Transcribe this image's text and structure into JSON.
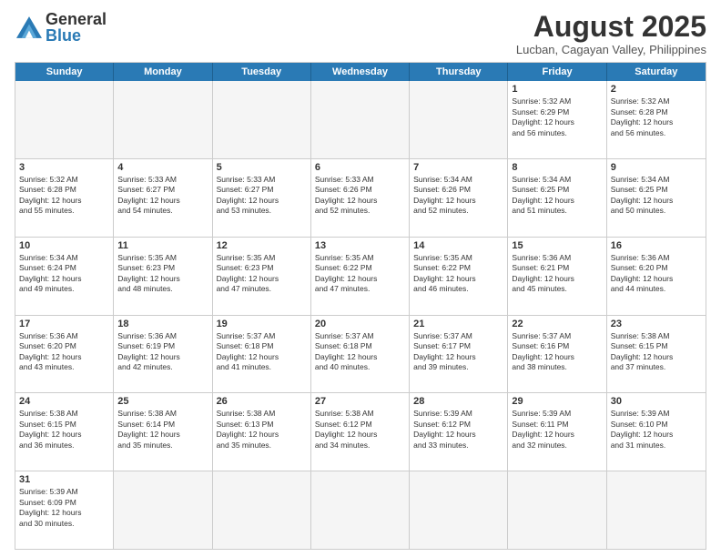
{
  "logo": {
    "general": "General",
    "blue": "Blue"
  },
  "title": {
    "month_year": "August 2025",
    "location": "Lucban, Cagayan Valley, Philippines"
  },
  "header": {
    "days": [
      "Sunday",
      "Monday",
      "Tuesday",
      "Wednesday",
      "Thursday",
      "Friday",
      "Saturday"
    ]
  },
  "weeks": [
    {
      "cells": [
        {
          "day": "",
          "info": "",
          "empty": true
        },
        {
          "day": "",
          "info": "",
          "empty": true
        },
        {
          "day": "",
          "info": "",
          "empty": true
        },
        {
          "day": "",
          "info": "",
          "empty": true
        },
        {
          "day": "",
          "info": "",
          "empty": true
        },
        {
          "day": "1",
          "info": "Sunrise: 5:32 AM\nSunset: 6:29 PM\nDaylight: 12 hours\nand 56 minutes.",
          "empty": false
        },
        {
          "day": "2",
          "info": "Sunrise: 5:32 AM\nSunset: 6:28 PM\nDaylight: 12 hours\nand 56 minutes.",
          "empty": false
        }
      ]
    },
    {
      "cells": [
        {
          "day": "3",
          "info": "Sunrise: 5:32 AM\nSunset: 6:28 PM\nDaylight: 12 hours\nand 55 minutes.",
          "empty": false
        },
        {
          "day": "4",
          "info": "Sunrise: 5:33 AM\nSunset: 6:27 PM\nDaylight: 12 hours\nand 54 minutes.",
          "empty": false
        },
        {
          "day": "5",
          "info": "Sunrise: 5:33 AM\nSunset: 6:27 PM\nDaylight: 12 hours\nand 53 minutes.",
          "empty": false
        },
        {
          "day": "6",
          "info": "Sunrise: 5:33 AM\nSunset: 6:26 PM\nDaylight: 12 hours\nand 52 minutes.",
          "empty": false
        },
        {
          "day": "7",
          "info": "Sunrise: 5:34 AM\nSunset: 6:26 PM\nDaylight: 12 hours\nand 52 minutes.",
          "empty": false
        },
        {
          "day": "8",
          "info": "Sunrise: 5:34 AM\nSunset: 6:25 PM\nDaylight: 12 hours\nand 51 minutes.",
          "empty": false
        },
        {
          "day": "9",
          "info": "Sunrise: 5:34 AM\nSunset: 6:25 PM\nDaylight: 12 hours\nand 50 minutes.",
          "empty": false
        }
      ]
    },
    {
      "cells": [
        {
          "day": "10",
          "info": "Sunrise: 5:34 AM\nSunset: 6:24 PM\nDaylight: 12 hours\nand 49 minutes.",
          "empty": false
        },
        {
          "day": "11",
          "info": "Sunrise: 5:35 AM\nSunset: 6:23 PM\nDaylight: 12 hours\nand 48 minutes.",
          "empty": false
        },
        {
          "day": "12",
          "info": "Sunrise: 5:35 AM\nSunset: 6:23 PM\nDaylight: 12 hours\nand 47 minutes.",
          "empty": false
        },
        {
          "day": "13",
          "info": "Sunrise: 5:35 AM\nSunset: 6:22 PM\nDaylight: 12 hours\nand 47 minutes.",
          "empty": false
        },
        {
          "day": "14",
          "info": "Sunrise: 5:35 AM\nSunset: 6:22 PM\nDaylight: 12 hours\nand 46 minutes.",
          "empty": false
        },
        {
          "day": "15",
          "info": "Sunrise: 5:36 AM\nSunset: 6:21 PM\nDaylight: 12 hours\nand 45 minutes.",
          "empty": false
        },
        {
          "day": "16",
          "info": "Sunrise: 5:36 AM\nSunset: 6:20 PM\nDaylight: 12 hours\nand 44 minutes.",
          "empty": false
        }
      ]
    },
    {
      "cells": [
        {
          "day": "17",
          "info": "Sunrise: 5:36 AM\nSunset: 6:20 PM\nDaylight: 12 hours\nand 43 minutes.",
          "empty": false
        },
        {
          "day": "18",
          "info": "Sunrise: 5:36 AM\nSunset: 6:19 PM\nDaylight: 12 hours\nand 42 minutes.",
          "empty": false
        },
        {
          "day": "19",
          "info": "Sunrise: 5:37 AM\nSunset: 6:18 PM\nDaylight: 12 hours\nand 41 minutes.",
          "empty": false
        },
        {
          "day": "20",
          "info": "Sunrise: 5:37 AM\nSunset: 6:18 PM\nDaylight: 12 hours\nand 40 minutes.",
          "empty": false
        },
        {
          "day": "21",
          "info": "Sunrise: 5:37 AM\nSunset: 6:17 PM\nDaylight: 12 hours\nand 39 minutes.",
          "empty": false
        },
        {
          "day": "22",
          "info": "Sunrise: 5:37 AM\nSunset: 6:16 PM\nDaylight: 12 hours\nand 38 minutes.",
          "empty": false
        },
        {
          "day": "23",
          "info": "Sunrise: 5:38 AM\nSunset: 6:15 PM\nDaylight: 12 hours\nand 37 minutes.",
          "empty": false
        }
      ]
    },
    {
      "cells": [
        {
          "day": "24",
          "info": "Sunrise: 5:38 AM\nSunset: 6:15 PM\nDaylight: 12 hours\nand 36 minutes.",
          "empty": false
        },
        {
          "day": "25",
          "info": "Sunrise: 5:38 AM\nSunset: 6:14 PM\nDaylight: 12 hours\nand 35 minutes.",
          "empty": false
        },
        {
          "day": "26",
          "info": "Sunrise: 5:38 AM\nSunset: 6:13 PM\nDaylight: 12 hours\nand 35 minutes.",
          "empty": false
        },
        {
          "day": "27",
          "info": "Sunrise: 5:38 AM\nSunset: 6:12 PM\nDaylight: 12 hours\nand 34 minutes.",
          "empty": false
        },
        {
          "day": "28",
          "info": "Sunrise: 5:39 AM\nSunset: 6:12 PM\nDaylight: 12 hours\nand 33 minutes.",
          "empty": false
        },
        {
          "day": "29",
          "info": "Sunrise: 5:39 AM\nSunset: 6:11 PM\nDaylight: 12 hours\nand 32 minutes.",
          "empty": false
        },
        {
          "day": "30",
          "info": "Sunrise: 5:39 AM\nSunset: 6:10 PM\nDaylight: 12 hours\nand 31 minutes.",
          "empty": false
        }
      ]
    },
    {
      "cells": [
        {
          "day": "31",
          "info": "Sunrise: 5:39 AM\nSunset: 6:09 PM\nDaylight: 12 hours\nand 30 minutes.",
          "empty": false
        },
        {
          "day": "",
          "info": "",
          "empty": true
        },
        {
          "day": "",
          "info": "",
          "empty": true
        },
        {
          "day": "",
          "info": "",
          "empty": true
        },
        {
          "day": "",
          "info": "",
          "empty": true
        },
        {
          "day": "",
          "info": "",
          "empty": true
        },
        {
          "day": "",
          "info": "",
          "empty": true
        }
      ]
    }
  ]
}
